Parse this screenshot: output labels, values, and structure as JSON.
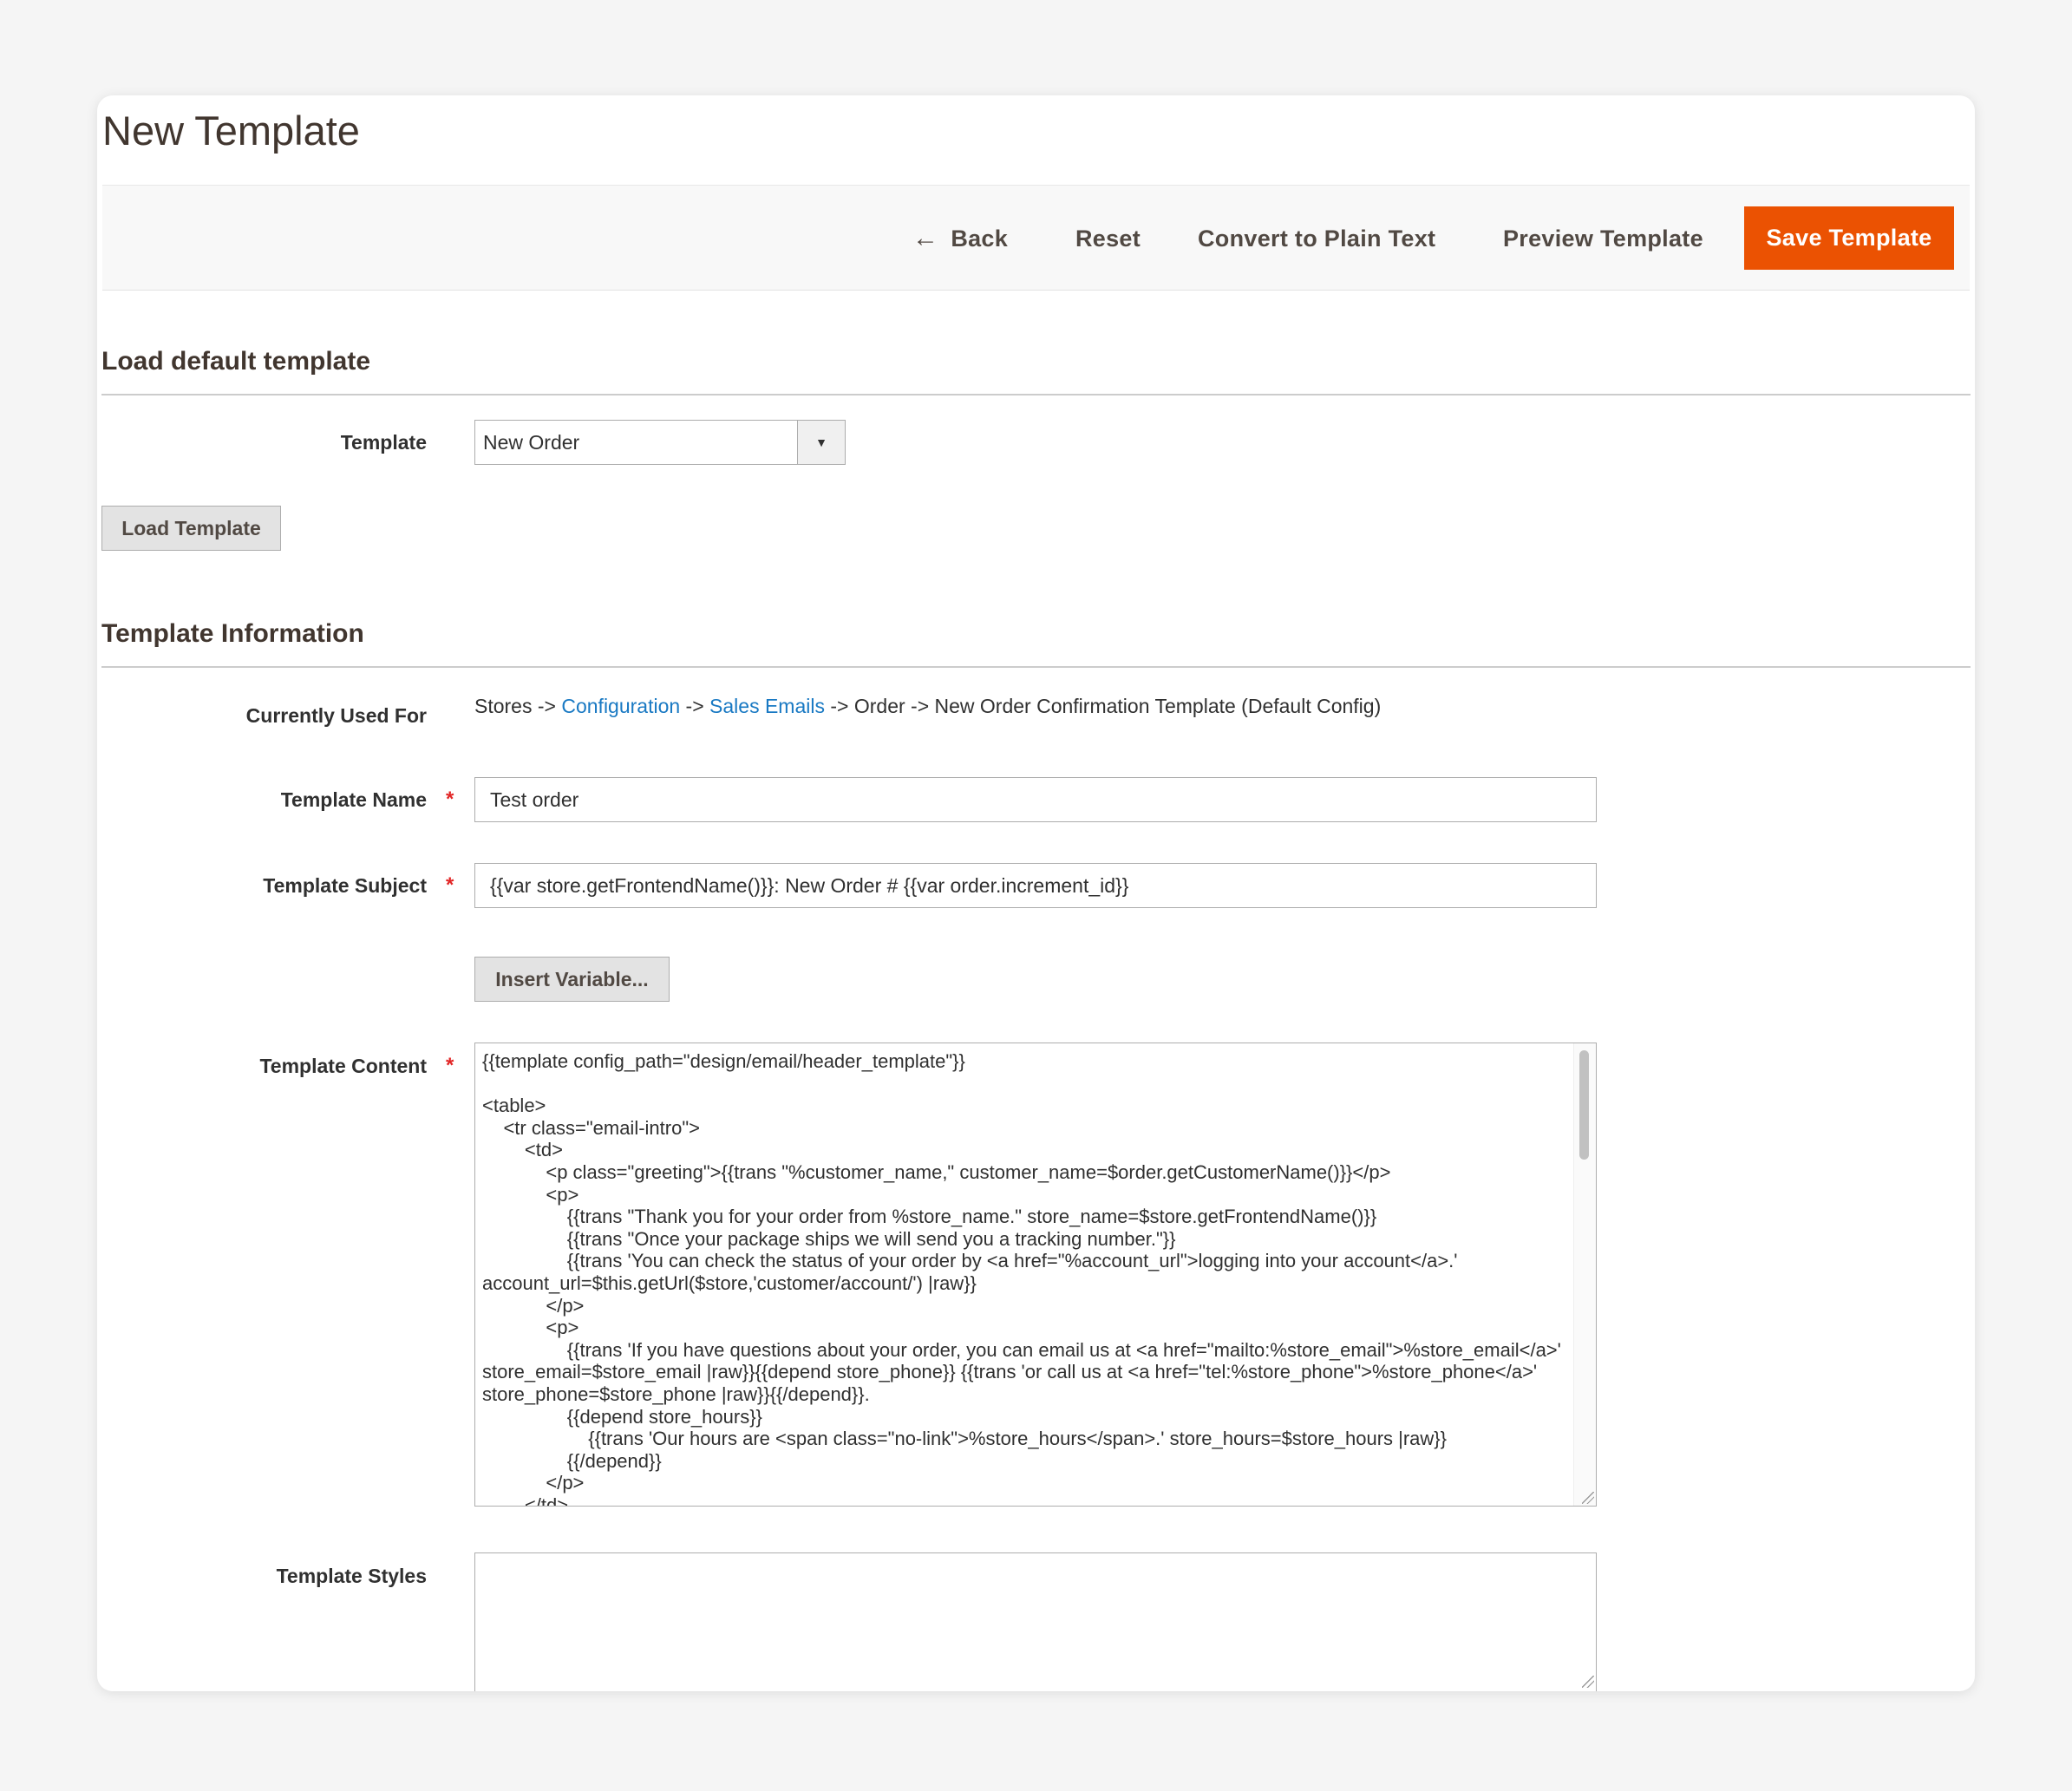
{
  "page_title": "New Template",
  "actions": {
    "back": "Back",
    "reset": "Reset",
    "convert": "Convert to Plain Text",
    "preview": "Preview Template",
    "save": "Save Template"
  },
  "load_section": {
    "title": "Load default template",
    "template_label": "Template",
    "template_value": "New Order",
    "load_button": "Load Template"
  },
  "info_section": {
    "title": "Template Information",
    "used_for_label": "Currently Used For",
    "used_for": {
      "stores": "Stores",
      "sep1": " -> ",
      "configuration": "Configuration",
      "sep2": " -> ",
      "sales_emails": "Sales Emails",
      "rest": " -> Order -> New Order Confirmation Template  (Default Config)"
    },
    "name_label": "Template Name",
    "name_value": "Test order",
    "subject_label": "Template Subject",
    "subject_value": "{{var store.getFrontendName()}}: New Order # {{var order.increment_id}}",
    "insert_variable": "Insert Variable...",
    "content_label": "Template Content",
    "content_value": "{{template config_path=\"design/email/header_template\"}}\n\n<table>\n    <tr class=\"email-intro\">\n        <td>\n            <p class=\"greeting\">{{trans \"%customer_name,\" customer_name=$order.getCustomerName()}}</p>\n            <p>\n                {{trans \"Thank you for your order from %store_name.\" store_name=$store.getFrontendName()}}\n                {{trans \"Once your package ships we will send you a tracking number.\"}}\n                {{trans 'You can check the status of your order by <a href=\"%account_url\">logging into your account</a>.' account_url=$this.getUrl($store,'customer/account/') |raw}}\n            </p>\n            <p>\n                {{trans 'If you have questions about your order, you can email us at <a href=\"mailto:%store_email\">%store_email</a>' store_email=$store_email |raw}}{{depend store_phone}} {{trans 'or call us at <a href=\"tel:%store_phone\">%store_phone</a>' store_phone=$store_phone |raw}}{{/depend}}.\n                {{depend store_hours}}\n                    {{trans 'Our hours are <span class=\"no-link\">%store_hours</span>.' store_hours=$store_hours |raw}}\n                {{/depend}}\n            </p>\n        </td>",
    "styles_label": "Template Styles",
    "styles_value": ""
  },
  "colors": {
    "primary": "#eb5202",
    "link": "#1979c3",
    "required": "#e22626"
  }
}
